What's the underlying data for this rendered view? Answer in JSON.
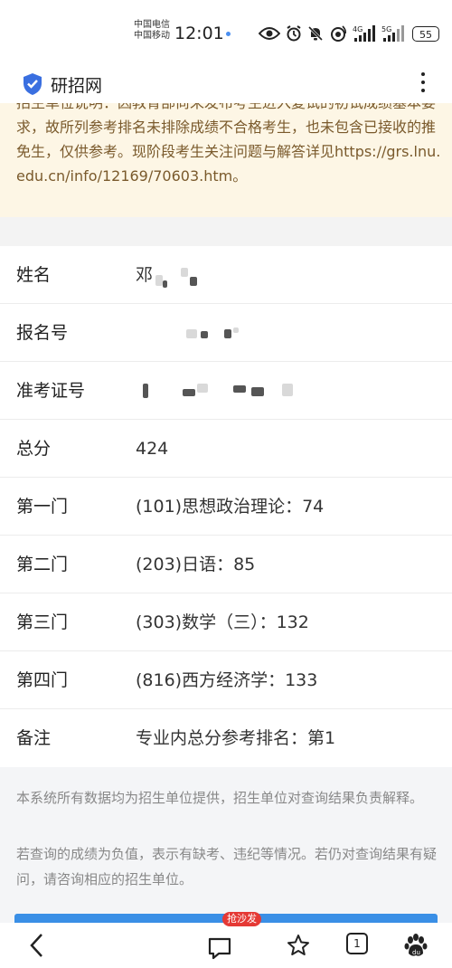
{
  "status_bar": {
    "carrier_1": "中国电信",
    "carrier_2": "中国移动",
    "time": "12:01",
    "network_1": "4G",
    "network_2": "5G",
    "battery": "55"
  },
  "app": {
    "title": "研招网",
    "accent_color": "#3a6fe0"
  },
  "notice": {
    "text": "招生单位说明：因教育部尚未发布考生进入复试的初试成绩基本要求，故所列参考排名未排除成绩不合格考生，也未包含已接收的推免生，仅供参考。现阶段考生关注问题与解答详见https://grs.lnu.edu.cn/info/12169/70603.htm。"
  },
  "info": {
    "name_label": "姓名",
    "name_value": "邓",
    "reg_label": "报名号",
    "ticket_label": "准考证号",
    "total_label": "总分",
    "total_value": "424",
    "subject1_label": "第一门",
    "subject1_value": "(101)思想政治理论：74",
    "subject2_label": "第二门",
    "subject2_value": "(203)日语：85",
    "subject3_label": "第三门",
    "subject3_value": "(303)数学（三）：132",
    "subject4_label": "第四门",
    "subject4_value": "(816)西方经济学：133",
    "remark_label": "备注",
    "remark_value": "专业内总分参考排名：第1"
  },
  "footer": {
    "note1": "本系统所有数据均为招生单位提供，招生单位对查询结果负责解释。",
    "note2": "若查询的成绩为负值，表示有缺考、违纪等情况。若仍对查询结果有疑问，请咨询相应的招生单位。"
  },
  "bottom_nav": {
    "comment_badge": "抢沙发",
    "tab_count": "1"
  }
}
